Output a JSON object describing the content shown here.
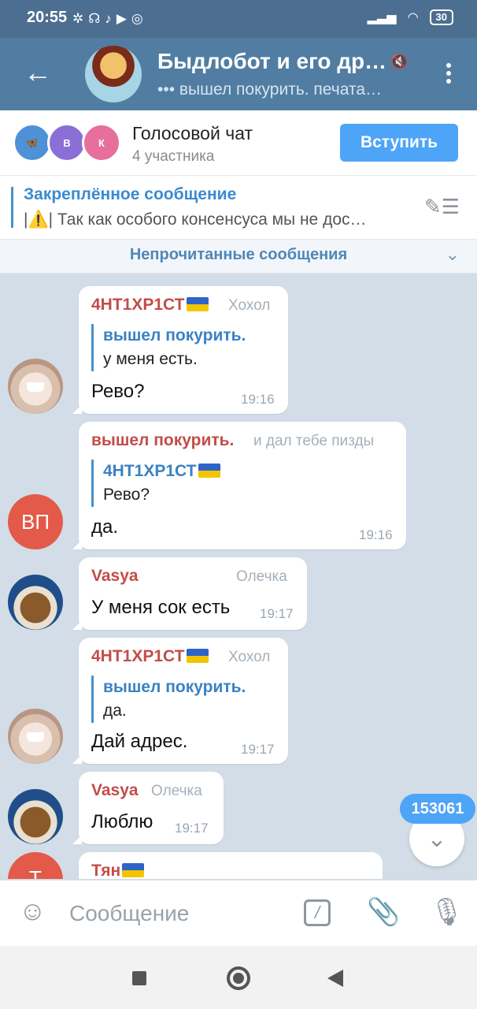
{
  "status_bar": {
    "time": "20:55",
    "battery": "30"
  },
  "header": {
    "title": "Быдлобот и его др…",
    "subtitle": "••• вышел покурить. печата…"
  },
  "voice_chat": {
    "avatars": [
      "В",
      "К"
    ],
    "title": "Голосовой чат",
    "participants": "4 участника",
    "join_label": "Вступить"
  },
  "pinned": {
    "label": "Закреплённое сообщение",
    "text": "|⚠️| Так как особого консенсуса мы не дос…"
  },
  "unread_label": "Непрочитанные сообщения",
  "messages": [
    {
      "author": "4НТ1ХР1СТ",
      "rank": "Хохол",
      "reply_name": "вышел покурить.",
      "reply_text": "у меня есть.",
      "text": "Рево?",
      "time": "19:16"
    },
    {
      "author": "вышел покурить.",
      "rank": "и дал тебе пизды",
      "avatar_initials": "ВП",
      "reply_name": "4НТ1ХР1СТ",
      "reply_text": "Рево?",
      "text": "да.",
      "time": "19:16"
    },
    {
      "author": "Vasya",
      "rank": "Олечка",
      "text": "У меня сок есть",
      "time": "19:17"
    },
    {
      "author": "4НТ1ХР1СТ",
      "rank": "Хохол",
      "reply_name": "вышел покурить.",
      "reply_text": "да.",
      "text": "Дай адрес.",
      "time": "19:17"
    },
    {
      "author": "Vasya",
      "rank": "Олечка",
      "text": "Люблю",
      "time": "19:17"
    },
    {
      "author": "Тян",
      "avatar_initials": "Т"
    }
  ],
  "unread_count": "153061",
  "input": {
    "placeholder": "Сообщение"
  }
}
